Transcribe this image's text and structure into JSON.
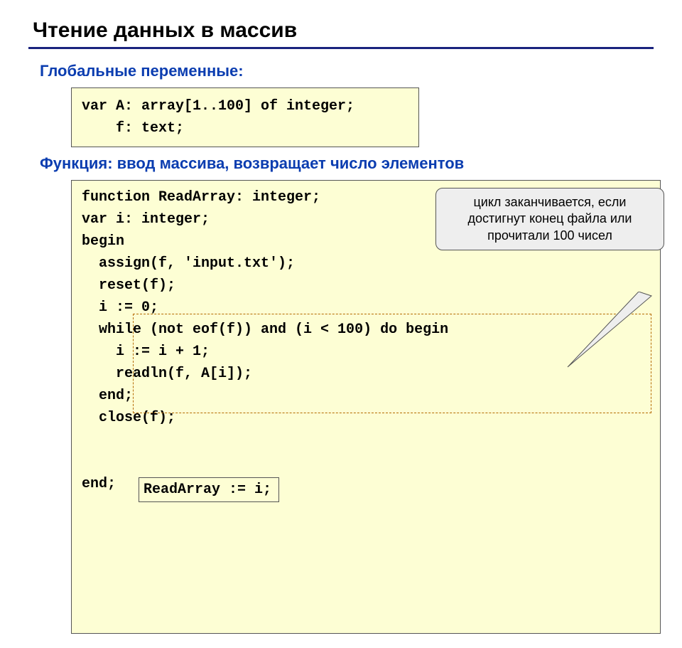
{
  "title": "Чтение данных в массив",
  "sections": {
    "globals_label": "Глобальные переменные:",
    "func_label": "Функция: ввод массива, возвращает число элементов"
  },
  "code": {
    "globals": "var A: array[1..100] of integer;\n    f: text;",
    "func_pre": "function ReadArray: integer;\nvar i: integer;\nbegin\n  assign(f, 'input.txt');\n  reset(f);\n  i := 0;",
    "func_loop": "  while (not eof(f)) and (i < 100) do begin\n    i := i + 1;\n    readln(f, A[i]);\n  end;",
    "func_post": "  close(f);\n\n\nend;",
    "return_stmt": "ReadArray := i;"
  },
  "callout": {
    "text": "цикл заканчивается, если достигнут конец файла или прочитали 100 чисел"
  }
}
